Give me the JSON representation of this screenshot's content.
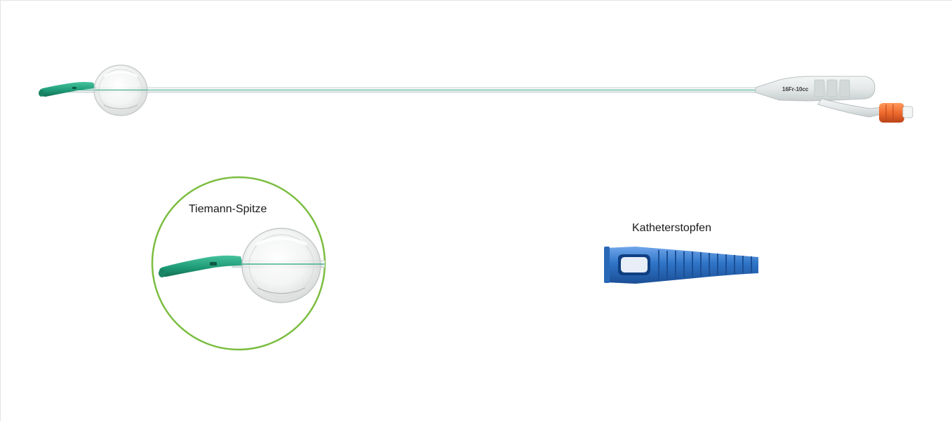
{
  "product": {
    "catheter_print": "16Fr-10cc",
    "tip_label": "Tiemann-Spitze",
    "stopper_label": "Katheterstopfen"
  },
  "colors": {
    "tip_green": "#1f9b78",
    "circle_green": "#7bbd3f",
    "stopper_blue": "#2f74c7",
    "valve_orange": "#ef6a2d"
  },
  "icons": {
    "catheter": "foley-catheter",
    "tip": "tiemann-tip",
    "stopper": "catheter-stopper"
  }
}
